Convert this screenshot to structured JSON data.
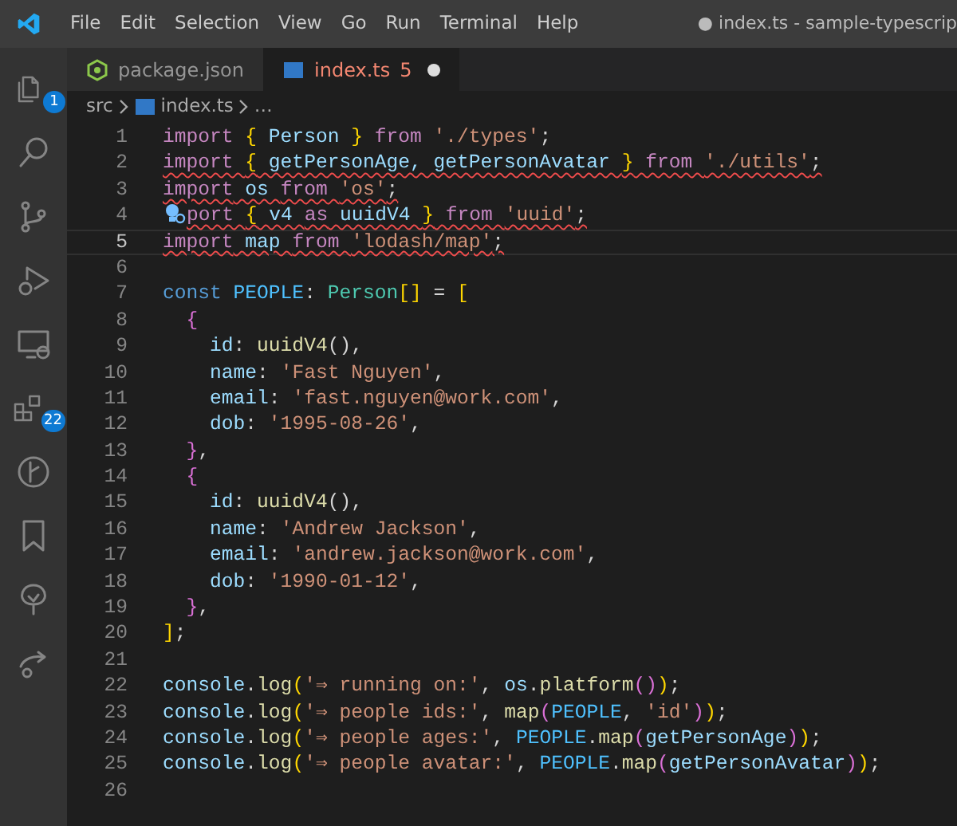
{
  "title_bar": {
    "menus": [
      "File",
      "Edit",
      "Selection",
      "View",
      "Go",
      "Run",
      "Terminal",
      "Help"
    ],
    "title": "● index.ts - sample-typescrip"
  },
  "activity_bar": [
    {
      "kind": "files",
      "badge": "1"
    },
    {
      "kind": "search"
    },
    {
      "kind": "branch"
    },
    {
      "kind": "debug"
    },
    {
      "kind": "remote"
    },
    {
      "kind": "extensions",
      "badge": "22"
    },
    {
      "kind": "graph"
    },
    {
      "kind": "bookmark"
    },
    {
      "kind": "tree"
    },
    {
      "kind": "share"
    }
  ],
  "tabs": [
    {
      "label": "package.json",
      "kind": "json",
      "selected": false,
      "has_errors": false
    },
    {
      "label": "index.ts",
      "kind": "ts",
      "selected": true,
      "has_errors": true,
      "problems": "5",
      "modified": true
    }
  ],
  "breadcrumb": [
    {
      "label": "src",
      "kind": "folder"
    },
    {
      "label": "index.ts",
      "kind": "ts"
    },
    {
      "label": "…",
      "kind": "symbol"
    }
  ],
  "code_lines": [
    {
      "number": "1",
      "error": false,
      "current": false,
      "tokens": [
        {
          "text": "import ",
          "kind": "k"
        },
        {
          "text": "{",
          "kind": "y"
        },
        {
          "text": " Person ",
          "kind": "v"
        },
        {
          "text": "}",
          "kind": "y"
        },
        {
          "text": " from ",
          "kind": "k"
        },
        {
          "text": "'./types'",
          "kind": "s"
        },
        {
          "text": ";",
          "kind": "p"
        }
      ]
    },
    {
      "number": "2",
      "error": true,
      "current": false,
      "tokens": [
        {
          "text": "import ",
          "kind": "k"
        },
        {
          "text": "{",
          "kind": "y"
        },
        {
          "text": " getPersonAge, getPersonAvatar ",
          "kind": "v"
        },
        {
          "text": "}",
          "kind": "y"
        },
        {
          "text": " from ",
          "kind": "k"
        },
        {
          "text": "'./utils'",
          "kind": "s"
        },
        {
          "text": ";",
          "kind": "p"
        }
      ]
    },
    {
      "number": "3",
      "error": true,
      "current": false,
      "tokens": [
        {
          "text": "import",
          "kind": "k"
        },
        {
          "text": " os ",
          "kind": "v"
        },
        {
          "text": "from ",
          "kind": "k"
        },
        {
          "text": "'os'",
          "kind": "s"
        },
        {
          "text": ";",
          "kind": "p"
        }
      ]
    },
    {
      "number": "4",
      "error": true,
      "current": false,
      "lightbulb": true,
      "tokens": [
        {
          "text": "port ",
          "kind": "k"
        },
        {
          "text": "{",
          "kind": "y"
        },
        {
          "text": " v4 ",
          "kind": "v"
        },
        {
          "text": "as",
          "kind": "k"
        },
        {
          "text": " uuidV4 ",
          "kind": "v"
        },
        {
          "text": "}",
          "kind": "y"
        },
        {
          "text": " from ",
          "kind": "k"
        },
        {
          "text": "'uuid'",
          "kind": "s"
        },
        {
          "text": ";",
          "kind": "p"
        }
      ]
    },
    {
      "number": "5",
      "error": true,
      "current": true,
      "tokens": [
        {
          "text": "import",
          "kind": "k"
        },
        {
          "text": " map ",
          "kind": "v"
        },
        {
          "text": "from ",
          "kind": "k"
        },
        {
          "text": "'lodash/map'",
          "kind": "s"
        },
        {
          "text": ";",
          "kind": "p"
        }
      ]
    },
    {
      "number": "6",
      "current": false
    },
    {
      "number": "7",
      "error": false,
      "current": false,
      "tokens": [
        {
          "text": "const ",
          "kind": "kb"
        },
        {
          "text": "PEOPLE",
          "kind": "c"
        },
        {
          "text": ": ",
          "kind": "p"
        },
        {
          "text": "Person",
          "kind": "t"
        },
        {
          "text": "[]",
          "kind": "y"
        },
        {
          "text": " = ",
          "kind": "p"
        },
        {
          "text": "[",
          "kind": "y"
        }
      ]
    },
    {
      "number": "8",
      "error": false,
      "current": false,
      "tokens": [
        {
          "text": "  {",
          "kind": "m"
        }
      ]
    },
    {
      "number": "9",
      "error": false,
      "current": false,
      "tokens": [
        {
          "text": "    id",
          "kind": "v"
        },
        {
          "text": ": ",
          "kind": "p"
        },
        {
          "text": "uuidV4",
          "kind": "f"
        },
        {
          "text": "(),",
          "kind": "p"
        }
      ]
    },
    {
      "number": "10",
      "error": false,
      "current": false,
      "tokens": [
        {
          "text": "    name",
          "kind": "v"
        },
        {
          "text": ": ",
          "kind": "p"
        },
        {
          "text": "'Fast Nguyen'",
          "kind": "s"
        },
        {
          "text": ",",
          "kind": "p"
        }
      ]
    },
    {
      "number": "11",
      "error": false,
      "current": false,
      "tokens": [
        {
          "text": "    email",
          "kind": "v"
        },
        {
          "text": ": ",
          "kind": "p"
        },
        {
          "text": "'fast.nguyen@work.com'",
          "kind": "s"
        },
        {
          "text": ",",
          "kind": "p"
        }
      ]
    },
    {
      "number": "12",
      "error": false,
      "current": false,
      "tokens": [
        {
          "text": "    dob",
          "kind": "v"
        },
        {
          "text": ": ",
          "kind": "p"
        },
        {
          "text": "'1995-08-26'",
          "kind": "s"
        },
        {
          "text": ",",
          "kind": "p"
        }
      ]
    },
    {
      "number": "13",
      "error": false,
      "current": false,
      "tokens": [
        {
          "text": "  }",
          "kind": "m"
        },
        {
          "text": ",",
          "kind": "p"
        }
      ]
    },
    {
      "number": "14",
      "error": false,
      "current": false,
      "tokens": [
        {
          "text": "  {",
          "kind": "m"
        }
      ]
    },
    {
      "number": "15",
      "error": false,
      "current": false,
      "tokens": [
        {
          "text": "    id",
          "kind": "v"
        },
        {
          "text": ": ",
          "kind": "p"
        },
        {
          "text": "uuidV4",
          "kind": "f"
        },
        {
          "text": "(),",
          "kind": "p"
        }
      ]
    },
    {
      "number": "16",
      "error": false,
      "current": false,
      "tokens": [
        {
          "text": "    name",
          "kind": "v"
        },
        {
          "text": ": ",
          "kind": "p"
        },
        {
          "text": "'Andrew Jackson'",
          "kind": "s"
        },
        {
          "text": ",",
          "kind": "p"
        }
      ]
    },
    {
      "number": "17",
      "error": false,
      "current": false,
      "tokens": [
        {
          "text": "    email",
          "kind": "v"
        },
        {
          "text": ": ",
          "kind": "p"
        },
        {
          "text": "'andrew.jackson@work.com'",
          "kind": "s"
        },
        {
          "text": ",",
          "kind": "p"
        }
      ]
    },
    {
      "number": "18",
      "error": false,
      "current": false,
      "tokens": [
        {
          "text": "    dob",
          "kind": "v"
        },
        {
          "text": ": ",
          "kind": "p"
        },
        {
          "text": "'1990-01-12'",
          "kind": "s"
        },
        {
          "text": ",",
          "kind": "p"
        }
      ]
    },
    {
      "number": "19",
      "error": false,
      "current": false,
      "tokens": [
        {
          "text": "  }",
          "kind": "m"
        },
        {
          "text": ",",
          "kind": "p"
        }
      ]
    },
    {
      "number": "20",
      "error": false,
      "current": false,
      "tokens": [
        {
          "text": "]",
          "kind": "y"
        },
        {
          "text": ";",
          "kind": "p"
        }
      ]
    },
    {
      "number": "21",
      "current": false
    },
    {
      "number": "22",
      "error": false,
      "current": false,
      "tokens": [
        {
          "text": "console",
          "kind": "v"
        },
        {
          "text": ".",
          "kind": "p"
        },
        {
          "text": "log",
          "kind": "f"
        },
        {
          "text": "(",
          "kind": "y"
        },
        {
          "text": "'⇒ running on:'",
          "kind": "s"
        },
        {
          "text": ", ",
          "kind": "p"
        },
        {
          "text": "os",
          "kind": "v"
        },
        {
          "text": ".",
          "kind": "p"
        },
        {
          "text": "platform",
          "kind": "f"
        },
        {
          "text": "()",
          "kind": "m"
        },
        {
          "text": ")",
          "kind": "y"
        },
        {
          "text": ";",
          "kind": "p"
        }
      ]
    },
    {
      "number": "23",
      "error": false,
      "current": false,
      "tokens": [
        {
          "text": "console",
          "kind": "v"
        },
        {
          "text": ".",
          "kind": "p"
        },
        {
          "text": "log",
          "kind": "f"
        },
        {
          "text": "(",
          "kind": "y"
        },
        {
          "text": "'⇒ people ids:'",
          "kind": "s"
        },
        {
          "text": ", ",
          "kind": "p"
        },
        {
          "text": "map",
          "kind": "f"
        },
        {
          "text": "(",
          "kind": "m"
        },
        {
          "text": "PEOPLE",
          "kind": "c"
        },
        {
          "text": ", ",
          "kind": "p"
        },
        {
          "text": "'id'",
          "kind": "s"
        },
        {
          "text": ")",
          "kind": "m"
        },
        {
          "text": ")",
          "kind": "y"
        },
        {
          "text": ";",
          "kind": "p"
        }
      ]
    },
    {
      "number": "24",
      "error": false,
      "current": false,
      "tokens": [
        {
          "text": "console",
          "kind": "v"
        },
        {
          "text": ".",
          "kind": "p"
        },
        {
          "text": "log",
          "kind": "f"
        },
        {
          "text": "(",
          "kind": "y"
        },
        {
          "text": "'⇒ people ages:'",
          "kind": "s"
        },
        {
          "text": ", ",
          "kind": "p"
        },
        {
          "text": "PEOPLE",
          "kind": "c"
        },
        {
          "text": ".",
          "kind": "p"
        },
        {
          "text": "map",
          "kind": "f"
        },
        {
          "text": "(",
          "kind": "m"
        },
        {
          "text": "getPersonAge",
          "kind": "v"
        },
        {
          "text": ")",
          "kind": "m"
        },
        {
          "text": ")",
          "kind": "y"
        },
        {
          "text": ";",
          "kind": "p"
        }
      ]
    },
    {
      "number": "25",
      "error": false,
      "current": false,
      "tokens": [
        {
          "text": "console",
          "kind": "v"
        },
        {
          "text": ".",
          "kind": "p"
        },
        {
          "text": "log",
          "kind": "f"
        },
        {
          "text": "(",
          "kind": "y"
        },
        {
          "text": "'⇒ people avatar:'",
          "kind": "s"
        },
        {
          "text": ", ",
          "kind": "p"
        },
        {
          "text": "PEOPLE",
          "kind": "c"
        },
        {
          "text": ".",
          "kind": "p"
        },
        {
          "text": "map",
          "kind": "f"
        },
        {
          "text": "(",
          "kind": "m"
        },
        {
          "text": "getPersonAvatar",
          "kind": "v"
        },
        {
          "text": ")",
          "kind": "m"
        },
        {
          "text": ")",
          "kind": "y"
        },
        {
          "text": ";",
          "kind": "p"
        }
      ]
    },
    {
      "number": "26",
      "current": false
    }
  ]
}
